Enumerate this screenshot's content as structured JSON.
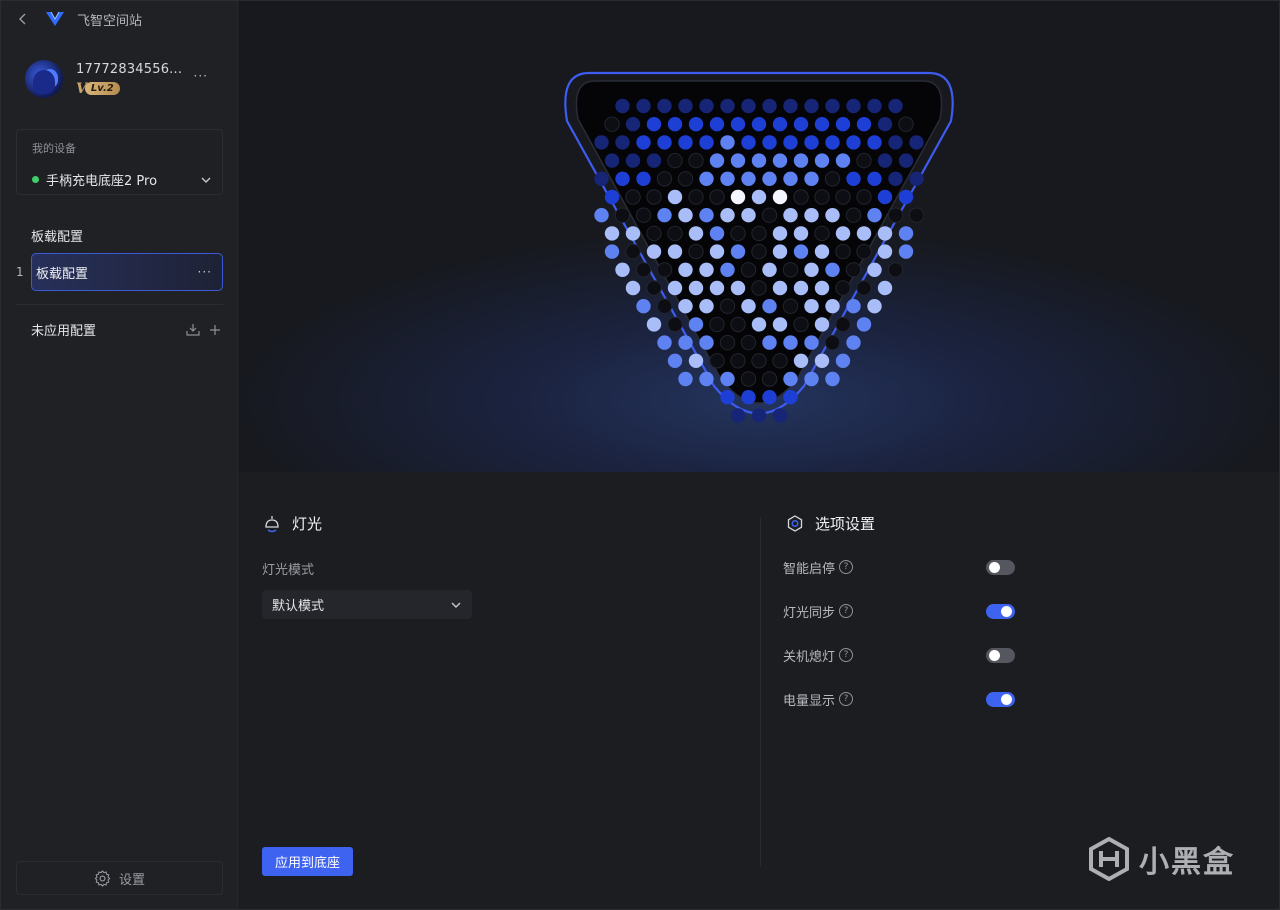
{
  "app": {
    "title": "飞智空间站"
  },
  "user": {
    "id": "17772834556...",
    "level": "Lv.2",
    "more": "···"
  },
  "device": {
    "section_label": "我的设备",
    "name": "手柄充电底座2 Pro",
    "status_color": "#3ecf6a"
  },
  "profiles": {
    "section_title": "板载配置",
    "items": [
      {
        "index": "1",
        "label": "板载配置",
        "more": "···"
      }
    ],
    "unapplied_title": "未应用配置"
  },
  "sidebar_footer": {
    "settings_label": "设置"
  },
  "lighting": {
    "title": "灯光",
    "mode_label": "灯光模式",
    "mode_value": "默认模式"
  },
  "options": {
    "title": "选项设置",
    "items": [
      {
        "label": "智能启停",
        "enabled": false
      },
      {
        "label": "灯光同步",
        "enabled": true
      },
      {
        "label": "关机熄灯",
        "enabled": false
      },
      {
        "label": "电量显示",
        "enabled": true
      }
    ]
  },
  "actions": {
    "apply_label": "应用到底座"
  },
  "watermark": {
    "text": "小黑盒"
  },
  "colors": {
    "accent": "#3d63f0",
    "accent_border": "#3b5bd6"
  },
  "led_matrix": {
    "palette": {
      "0": "#0d0e14",
      "1": "#162576",
      "2": "#1d3fd6",
      "3": "#5f82f2",
      "4": "#a9bef8",
      "5": "#f3f6ff"
    },
    "rows": [
      "11111111111111",
      "012222222222210",
      "1122223222222211",
      "111003333333011",
      "1220033333302211",
      "200400545000022",
      "3003434404440300",
      "440043004404443",
      "304404304340043",
      "40044304043040",
      "4044440444004",
      "304404304434",
      "40300440403",
      "3330033303",
      "340000443",
      "33300333",
      "2222",
      "111"
    ]
  }
}
